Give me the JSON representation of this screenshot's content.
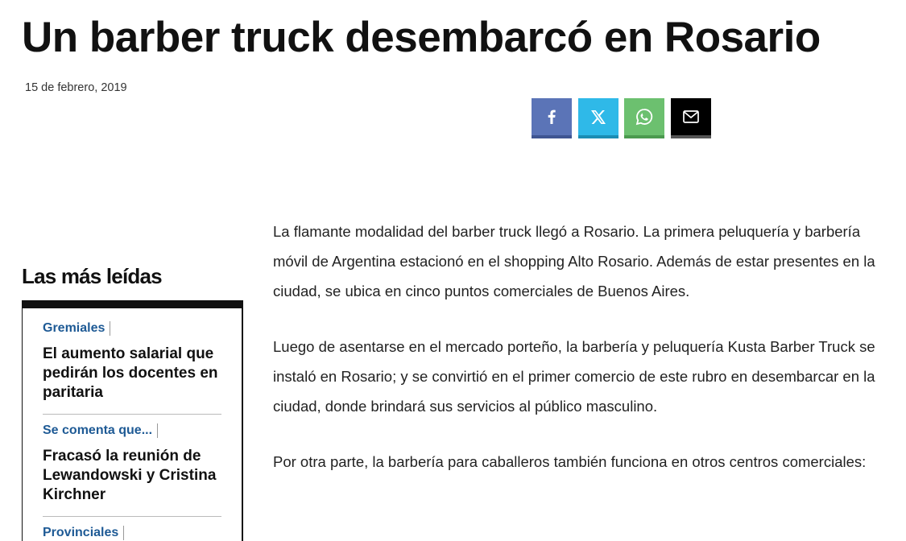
{
  "article": {
    "title": "Un barber truck desembarcó en Rosario",
    "date": "15 de febrero, 2019",
    "paragraphs": [
      "La flamante modalidad del barber truck llegó a Rosario. La primera peluquería y barbería móvil de Argentina estacionó en el shopping Alto Rosario. Además de estar presentes en la ciudad, se ubica en cinco puntos comerciales de Buenos Aires.",
      "Luego de asentarse en el mercado porteño, la barbería y peluquería Kusta Barber Truck se instaló en Rosario; y se convirtió en el primer comercio de este rubro en desembarcar en la ciudad, donde brindará sus servicios al público masculino.",
      "Por otra parte, la barbería para caballeros también funciona en otros centros comerciales:"
    ]
  },
  "share": {
    "buttons": [
      {
        "name": "facebook",
        "icon": "facebook-icon",
        "color": "#5b74b7"
      },
      {
        "name": "x",
        "icon": "x-icon",
        "color": "#2fb9e8"
      },
      {
        "name": "whatsapp",
        "icon": "whatsapp-icon",
        "color": "#6cc06f"
      },
      {
        "name": "email",
        "icon": "mail-icon",
        "color": "#000000"
      }
    ]
  },
  "sidebar": {
    "heading": "Las más leídas",
    "items": [
      {
        "category": "Gremiales",
        "title": "El aumento salarial que pedirán los docentes en paritaria"
      },
      {
        "category": "Se comenta que...",
        "title": "Fracasó la reunión de Lewandowski y Cristina Kirchner"
      },
      {
        "category": "Provinciales",
        "title": ""
      }
    ]
  },
  "colors": {
    "category_link": "#1e5a95",
    "text": "#111111"
  }
}
